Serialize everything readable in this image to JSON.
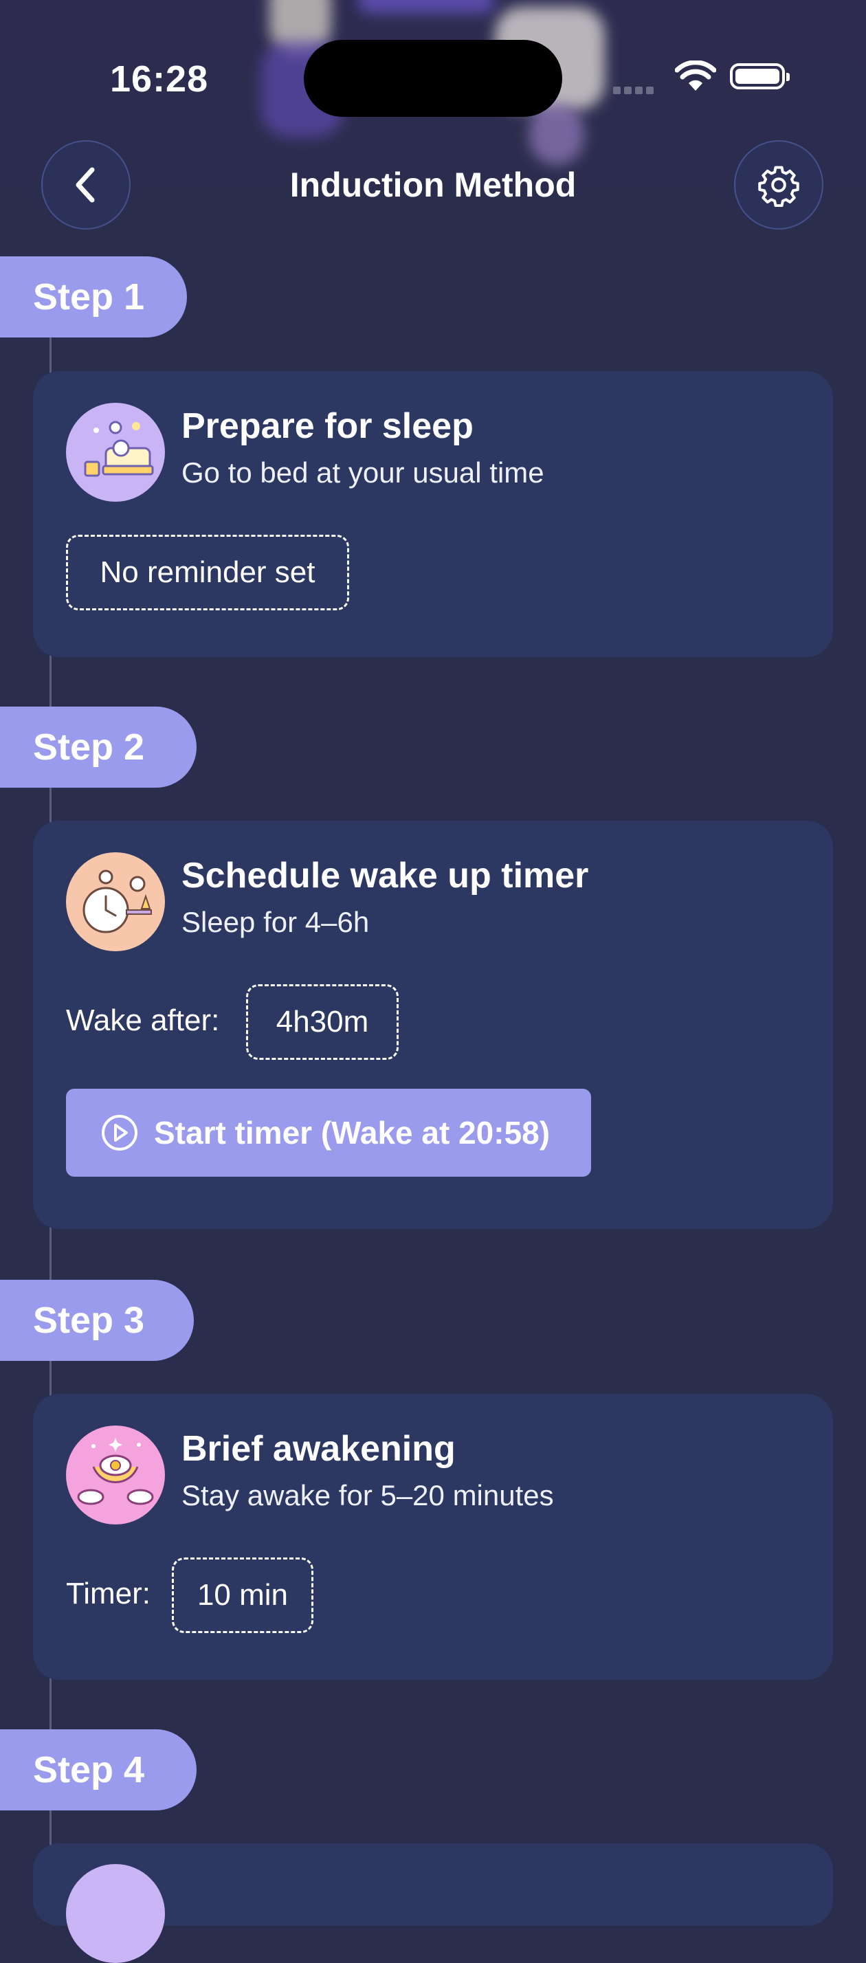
{
  "status_bar": {
    "time": "16:28"
  },
  "header": {
    "title": "Induction Method"
  },
  "steps": [
    {
      "step_label": "Step 1",
      "title": "Prepare for sleep",
      "subtitle": "Go to bed at your usual time",
      "reminder": "No reminder set",
      "avatar_icon": "bedroom-illustration-icon",
      "avatar_color": "#c9b5f5"
    },
    {
      "step_label": "Step 2",
      "title": "Schedule wake up timer",
      "subtitle": "Sleep for 4–6h",
      "wake_after_label": "Wake after:",
      "wake_after_value": "4h30m",
      "button_label": "Start timer (Wake at 20:58)",
      "avatar_icon": "alarm-clock-illustration-icon",
      "avatar_color": "#f8c6ab"
    },
    {
      "step_label": "Step 3",
      "title": "Brief awakening",
      "subtitle": "Stay awake for 5–20 minutes",
      "timer_label": "Timer:",
      "timer_value": "10 min",
      "avatar_icon": "moon-eye-illustration-icon",
      "avatar_color": "#f5a3dc"
    },
    {
      "step_label": "Step 4"
    }
  ],
  "colors": {
    "background": "#2a2d4c",
    "card": "#2c3762",
    "accent": "#9a9bed"
  }
}
